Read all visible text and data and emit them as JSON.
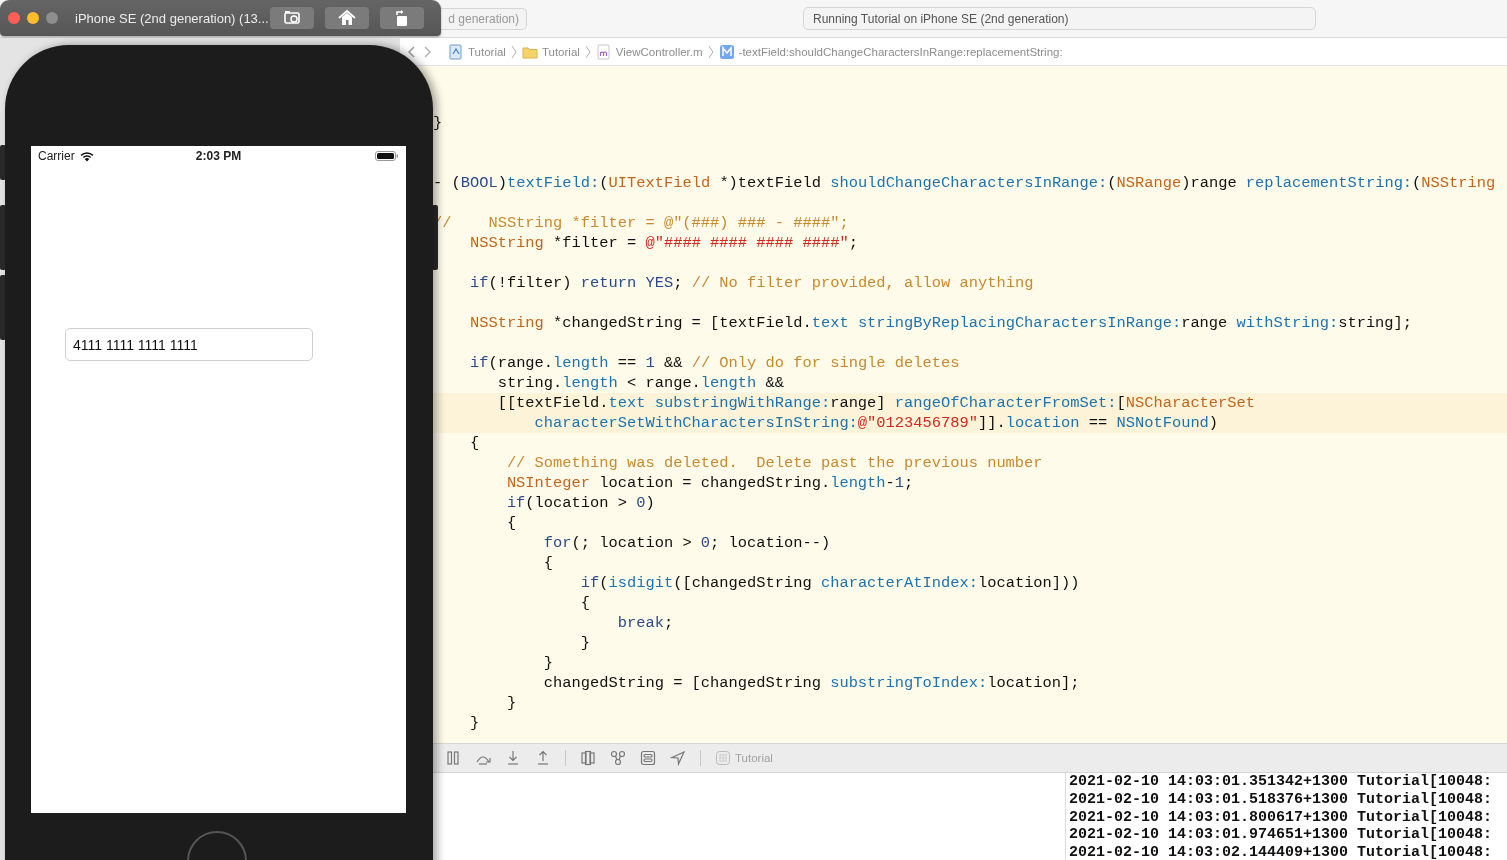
{
  "simulator": {
    "title": "iPhone SE (2nd generation) (13...",
    "buttons": [
      {
        "kind": "screenshot"
      },
      {
        "kind": "home"
      },
      {
        "kind": "rotate"
      }
    ],
    "status_bar": {
      "carrier": "Carrier",
      "time": "2:03 PM"
    },
    "text_field": {
      "value": "4111 1111 1111 1111"
    }
  },
  "xcode": {
    "scheme": "d generation)",
    "activity": "Running Tutorial on iPhone SE (2nd generation)",
    "breadcrumbs": [
      {
        "label": "Tutorial",
        "kind": "project"
      },
      {
        "label": "Tutorial",
        "kind": "folder"
      },
      {
        "label": "ViewController.m",
        "kind": "source"
      },
      {
        "label": "-textField:shouldChangeCharactersInRange:replacementString:",
        "kind": "method"
      }
    ],
    "code_lines": [
      {
        "kind": "blank",
        "highlighted": false
      },
      {
        "kind": "blank",
        "highlighted": false
      },
      {
        "kind": "code",
        "highlighted": false,
        "tokens": [
          {
            "text": "}",
            "kind": "plain"
          }
        ]
      },
      {
        "kind": "blank",
        "highlighted": false
      },
      {
        "kind": "blank",
        "highlighted": false
      },
      {
        "kind": "code",
        "highlighted": false,
        "tokens": [
          {
            "text": "- (",
            "kind": "plain"
          },
          {
            "text": "BOOL",
            "kind": "keyword"
          },
          {
            "text": ")",
            "kind": "plain"
          },
          {
            "text": "textField:",
            "kind": "method"
          },
          {
            "text": "(",
            "kind": "plain"
          },
          {
            "text": "UITextField",
            "kind": "type"
          },
          {
            "text": " *)textField ",
            "kind": "plain"
          },
          {
            "text": "shouldChangeCharactersInRange:",
            "kind": "method"
          },
          {
            "text": "(",
            "kind": "plain"
          },
          {
            "text": "NSRange",
            "kind": "type"
          },
          {
            "text": ")range ",
            "kind": "plain"
          },
          {
            "text": "replacementString:",
            "kind": "method"
          },
          {
            "text": "(",
            "kind": "plain"
          },
          {
            "text": "NSString",
            "kind": "type"
          }
        ]
      },
      {
        "kind": "blank",
        "highlighted": false
      },
      {
        "kind": "code",
        "highlighted": false,
        "tokens": [
          {
            "text": "//    NSString *filter = @\"(###) ### - ####\";",
            "kind": "comment"
          }
        ]
      },
      {
        "kind": "code",
        "highlighted": false,
        "tokens": [
          {
            "text": "    NSString",
            "kind": "type"
          },
          {
            "text": " *filter = ",
            "kind": "plain"
          },
          {
            "text": "@\"#### #### #### ####\"",
            "kind": "string"
          },
          {
            "text": ";",
            "kind": "plain"
          }
        ]
      },
      {
        "kind": "blank",
        "highlighted": false
      },
      {
        "kind": "code",
        "highlighted": false,
        "tokens": [
          {
            "text": "    if",
            "kind": "keyword"
          },
          {
            "text": "(!filter) ",
            "kind": "plain"
          },
          {
            "text": "return",
            "kind": "keyword"
          },
          {
            "text": " YES",
            "kind": "keyword"
          },
          {
            "text": "; ",
            "kind": "plain"
          },
          {
            "text": "// No filter provided, allow anything",
            "kind": "comment"
          }
        ]
      },
      {
        "kind": "blank",
        "highlighted": false
      },
      {
        "kind": "code",
        "highlighted": false,
        "tokens": [
          {
            "text": "    NSString",
            "kind": "type"
          },
          {
            "text": " *changedString = [textField.",
            "kind": "plain"
          },
          {
            "text": "text",
            "kind": "method"
          },
          {
            "text": " stringByReplacingCharactersInRange:",
            "kind": "method"
          },
          {
            "text": "range ",
            "kind": "plain"
          },
          {
            "text": "withString:",
            "kind": "method"
          },
          {
            "text": "string];",
            "kind": "plain"
          }
        ]
      },
      {
        "kind": "blank",
        "highlighted": false
      },
      {
        "kind": "code",
        "highlighted": false,
        "tokens": [
          {
            "text": "    if",
            "kind": "keyword"
          },
          {
            "text": "(range.",
            "kind": "plain"
          },
          {
            "text": "length",
            "kind": "method"
          },
          {
            "text": " == ",
            "kind": "plain"
          },
          {
            "text": "1",
            "kind": "number"
          },
          {
            "text": " && ",
            "kind": "plain"
          },
          {
            "text": "// Only do for single deletes",
            "kind": "comment"
          }
        ]
      },
      {
        "kind": "code",
        "highlighted": false,
        "tokens": [
          {
            "text": "       string.",
            "kind": "plain"
          },
          {
            "text": "length",
            "kind": "method"
          },
          {
            "text": " < range.",
            "kind": "plain"
          },
          {
            "text": "length",
            "kind": "method"
          },
          {
            "text": " &&",
            "kind": "plain"
          }
        ]
      },
      {
        "kind": "code",
        "highlighted": true,
        "tokens": [
          {
            "text": "       [[textField.",
            "kind": "plain"
          },
          {
            "text": "text",
            "kind": "method"
          },
          {
            "text": " substringWithRange:",
            "kind": "method"
          },
          {
            "text": "range] ",
            "kind": "plain"
          },
          {
            "text": "rangeOfCharacterFromSet:",
            "kind": "method"
          },
          {
            "text": "[",
            "kind": "plain"
          },
          {
            "text": "NSCharacterSet",
            "kind": "type"
          }
        ]
      },
      {
        "kind": "code",
        "highlighted": true,
        "tokens": [
          {
            "text": "           characterSetWithCharactersInString:",
            "kind": "method"
          },
          {
            "text": "@\"0123456789\"",
            "kind": "string"
          },
          {
            "text": "]].",
            "kind": "plain"
          },
          {
            "text": "location",
            "kind": "method"
          },
          {
            "text": " == ",
            "kind": "plain"
          },
          {
            "text": "NSNotFound",
            "kind": "method"
          },
          {
            "text": ")",
            "kind": "plain"
          }
        ]
      },
      {
        "kind": "code",
        "highlighted": false,
        "tokens": [
          {
            "text": "    {",
            "kind": "plain"
          }
        ]
      },
      {
        "kind": "code",
        "highlighted": false,
        "tokens": [
          {
            "text": "        // Something was deleted.  Delete past the previous number",
            "kind": "comment"
          }
        ]
      },
      {
        "kind": "code",
        "highlighted": false,
        "tokens": [
          {
            "text": "        NSInteger",
            "kind": "type"
          },
          {
            "text": " location = changedString.",
            "kind": "plain"
          },
          {
            "text": "length",
            "kind": "method"
          },
          {
            "text": "-",
            "kind": "plain"
          },
          {
            "text": "1",
            "kind": "number"
          },
          {
            "text": ";",
            "kind": "plain"
          }
        ]
      },
      {
        "kind": "code",
        "highlighted": false,
        "tokens": [
          {
            "text": "        if",
            "kind": "keyword"
          },
          {
            "text": "(location > ",
            "kind": "plain"
          },
          {
            "text": "0",
            "kind": "number"
          },
          {
            "text": ")",
            "kind": "plain"
          }
        ]
      },
      {
        "kind": "code",
        "highlighted": false,
        "tokens": [
          {
            "text": "        {",
            "kind": "plain"
          }
        ]
      },
      {
        "kind": "code",
        "highlighted": false,
        "tokens": [
          {
            "text": "            for",
            "kind": "keyword"
          },
          {
            "text": "(; location > ",
            "kind": "plain"
          },
          {
            "text": "0",
            "kind": "number"
          },
          {
            "text": "; location--)",
            "kind": "plain"
          }
        ]
      },
      {
        "kind": "code",
        "highlighted": false,
        "tokens": [
          {
            "text": "            {",
            "kind": "plain"
          }
        ]
      },
      {
        "kind": "code",
        "highlighted": false,
        "tokens": [
          {
            "text": "                if",
            "kind": "keyword"
          },
          {
            "text": "(",
            "kind": "plain"
          },
          {
            "text": "isdigit",
            "kind": "method"
          },
          {
            "text": "([changedString ",
            "kind": "plain"
          },
          {
            "text": "characterAtIndex:",
            "kind": "method"
          },
          {
            "text": "location]))",
            "kind": "plain"
          }
        ]
      },
      {
        "kind": "code",
        "highlighted": false,
        "tokens": [
          {
            "text": "                {",
            "kind": "plain"
          }
        ]
      },
      {
        "kind": "code",
        "highlighted": false,
        "tokens": [
          {
            "text": "                    break",
            "kind": "keyword"
          },
          {
            "text": ";",
            "kind": "plain"
          }
        ]
      },
      {
        "kind": "code",
        "highlighted": false,
        "tokens": [
          {
            "text": "                }",
            "kind": "plain"
          }
        ]
      },
      {
        "kind": "code",
        "highlighted": false,
        "tokens": [
          {
            "text": "            }",
            "kind": "plain"
          }
        ]
      },
      {
        "kind": "code",
        "highlighted": false,
        "tokens": [
          {
            "text": "            changedString = [changedString ",
            "kind": "plain"
          },
          {
            "text": "substringToIndex:",
            "kind": "method"
          },
          {
            "text": "location];",
            "kind": "plain"
          }
        ]
      },
      {
        "kind": "code",
        "highlighted": false,
        "tokens": [
          {
            "text": "        }",
            "kind": "plain"
          }
        ]
      },
      {
        "kind": "code",
        "highlighted": false,
        "tokens": [
          {
            "text": "    }",
            "kind": "plain"
          }
        ]
      }
    ],
    "debug_tools": [
      {
        "kind": "pause"
      },
      {
        "kind": "step_over"
      },
      {
        "kind": "step_into"
      },
      {
        "kind": "step_out"
      },
      {
        "kind": "view_debugger"
      },
      {
        "kind": "memory_graph"
      },
      {
        "kind": "environment"
      },
      {
        "kind": "location"
      }
    ],
    "debug_target": "Tutorial",
    "console_lines": [
      "2021-02-10 14:03:01.351342+1300 Tutorial[10048:",
      "2021-02-10 14:03:01.518376+1300 Tutorial[10048:",
      "2021-02-10 14:03:01.800617+1300 Tutorial[10048:",
      "2021-02-10 14:03:01.974651+1300 Tutorial[10048:",
      "2021-02-10 14:03:02.144409+1300 Tutorial[10048:"
    ]
  }
}
